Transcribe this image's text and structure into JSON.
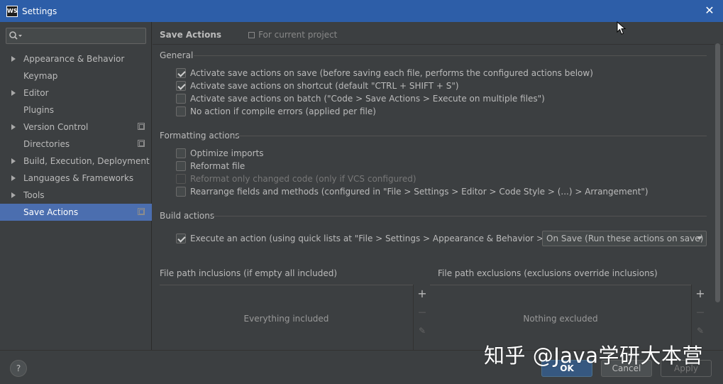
{
  "window": {
    "title": "Settings",
    "app_icon_text": "WS",
    "close_icon": "close-icon"
  },
  "sidebar": {
    "search": {
      "value": "",
      "placeholder": "",
      "icon": "search-icon"
    },
    "items": [
      {
        "label": "Appearance & Behavior",
        "expandable": true,
        "project_icon": false,
        "selected": false
      },
      {
        "label": "Keymap",
        "expandable": false,
        "project_icon": false,
        "selected": false
      },
      {
        "label": "Editor",
        "expandable": true,
        "project_icon": false,
        "selected": false
      },
      {
        "label": "Plugins",
        "expandable": false,
        "project_icon": false,
        "selected": false
      },
      {
        "label": "Version Control",
        "expandable": true,
        "project_icon": true,
        "selected": false
      },
      {
        "label": "Directories",
        "expandable": false,
        "project_icon": true,
        "selected": false
      },
      {
        "label": "Build, Execution, Deployment",
        "expandable": true,
        "project_icon": false,
        "selected": false
      },
      {
        "label": "Languages & Frameworks",
        "expandable": true,
        "project_icon": false,
        "selected": false
      },
      {
        "label": "Tools",
        "expandable": true,
        "project_icon": false,
        "selected": false
      },
      {
        "label": "Save Actions",
        "expandable": false,
        "project_icon": true,
        "selected": true
      }
    ]
  },
  "main": {
    "title": "Save Actions",
    "scope_label": "For current project",
    "general": {
      "title": "General",
      "options": [
        {
          "label": "Activate save actions on save (before saving each file, performs the configured actions below)",
          "checked": true,
          "disabled": false
        },
        {
          "label": "Activate save actions on shortcut (default \"CTRL + SHIFT + S\")",
          "checked": true,
          "disabled": false
        },
        {
          "label": "Activate save actions on batch (\"Code > Save Actions > Execute on multiple files\")",
          "checked": false,
          "disabled": false
        },
        {
          "label": "No action if compile errors (applied per file)",
          "checked": false,
          "disabled": false
        }
      ]
    },
    "formatting": {
      "title": "Formatting actions",
      "options": [
        {
          "label": "Optimize imports",
          "checked": false,
          "disabled": false
        },
        {
          "label": "Reformat file",
          "checked": false,
          "disabled": false
        },
        {
          "label": "Reformat only changed code (only if VCS configured)",
          "checked": false,
          "disabled": true
        },
        {
          "label": "Rearrange fields and methods (configured in \"File > Settings > Editor > Code Style > (...) > Arrangement\")",
          "checked": false,
          "disabled": false
        }
      ]
    },
    "build": {
      "title": "Build actions",
      "option": {
        "label": "Execute an action (using quick lists at \"File > Settings > Appearance & Behavior > Quick Lists\"",
        "checked": true
      },
      "combo_value": "On Save (Run these actions on save)"
    },
    "inclusions": {
      "label": "File path inclusions (if empty all included)",
      "empty_text": "Everything included"
    },
    "exclusions": {
      "label": "File path exclusions (exclusions override inclusions)",
      "empty_text": "Nothing excluded"
    },
    "toolbar": {
      "add": "+",
      "remove": "—",
      "edit": "✎"
    }
  },
  "footer": {
    "help": "?",
    "ok": "OK",
    "cancel": "Cancel",
    "apply": "Apply"
  },
  "watermark": "知乎 @Java学研大本营",
  "colors": {
    "selection": "#4b6eaf",
    "titlebar": "#2d5ea8",
    "background": "#3c3f41",
    "primary_button": "#365880"
  }
}
